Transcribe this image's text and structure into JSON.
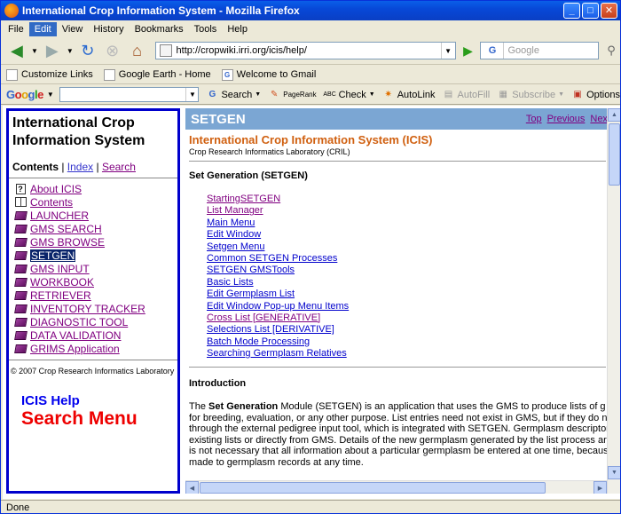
{
  "window": {
    "title": "International Crop Information System - Mozilla Firefox",
    "min": "_",
    "max": "□",
    "close": "✕"
  },
  "menu": [
    "File",
    "Edit",
    "View",
    "History",
    "Bookmarks",
    "Tools",
    "Help"
  ],
  "nav": {
    "url": "http://cropwiki.irri.org/icis/help/",
    "search_placeholder": "Google",
    "search_engine": "G"
  },
  "bookmarks": [
    "Customize Links",
    "Google Earth - Home",
    "Welcome to Gmail"
  ],
  "google_toolbar": {
    "search": "Search",
    "pagerank": "PageRank",
    "check": "Check",
    "autolink": "AutoLink",
    "autofill": "AutoFill",
    "subscribe": "Subscribe",
    "options": "Options"
  },
  "left": {
    "title_line1": "International Crop",
    "title_line2": "Information System",
    "tab_contents": "Contents",
    "tab_index": "Index",
    "tab_search": "Search",
    "items": [
      {
        "label": "About ICIS",
        "icon": "help-page-icon"
      },
      {
        "label": "Contents",
        "icon": "open-book-icon"
      },
      {
        "label": "LAUNCHER",
        "icon": "book-icon"
      },
      {
        "label": "GMS SEARCH",
        "icon": "book-icon"
      },
      {
        "label": "GMS BROWSE",
        "icon": "book-icon"
      },
      {
        "label": "SETGEN",
        "icon": "book-icon"
      },
      {
        "label": "GMS INPUT",
        "icon": "book-icon"
      },
      {
        "label": "WORKBOOK",
        "icon": "book-icon"
      },
      {
        "label": "RETRIEVER",
        "icon": "book-icon"
      },
      {
        "label": "INVENTORY TRACKER",
        "icon": "book-icon"
      },
      {
        "label": "DIAGNOSTIC TOOL",
        "icon": "book-icon"
      },
      {
        "label": "DATA VALIDATION",
        "icon": "book-icon"
      },
      {
        "label": "GRIMS Application",
        "icon": "book-icon"
      }
    ],
    "copyright": "© 2007 Crop Research Informatics Laboratory",
    "help_line1": "ICIS Help",
    "help_line2": "Search Menu"
  },
  "right": {
    "header": "SETGEN",
    "nav_top": "Top",
    "nav_prev": "Previous",
    "nav_next": "Next",
    "system": "International Crop Information System (ICIS)",
    "lab": "Crop Research Informatics Laboratory (CRIL)",
    "section": "Set Generation (SETGEN)",
    "links": [
      "StartingSETGEN",
      "List Manager",
      "Main Menu",
      "Edit Window",
      "Setgen Menu",
      "Common SETGEN Processes",
      "SETGEN GMSTools",
      "Basic Lists",
      "Edit Germplasm List",
      "Edit Window Pop-up Menu Items",
      "Cross List [GENERATIVE]",
      "Selections List [DERIVATIVE]",
      "Batch Mode Processing",
      "Searching Germplasm Relatives"
    ],
    "intro_heading": "Introduction",
    "intro_lead": "The ",
    "intro_bold": "Set Generation",
    "intro_line1": " Module (SETGEN) is an application that uses the GMS to produce lists of g",
    "intro_line2": "for breeding, evaluation, or any other purpose. List entries need not exist in GMS, but if they do n",
    "intro_line3": "through the external pedigree input tool, which is integrated with SETGEN. Germplasm descriptors",
    "intro_line4": "existing lists or directly from GMS. Details of the new germplasm generated by the list process ar",
    "intro_line5": "is not necessary that all information about a particular germplasm be entered at one time, becaus",
    "intro_line6": "made to germplasm records at any time."
  },
  "status": "Done"
}
